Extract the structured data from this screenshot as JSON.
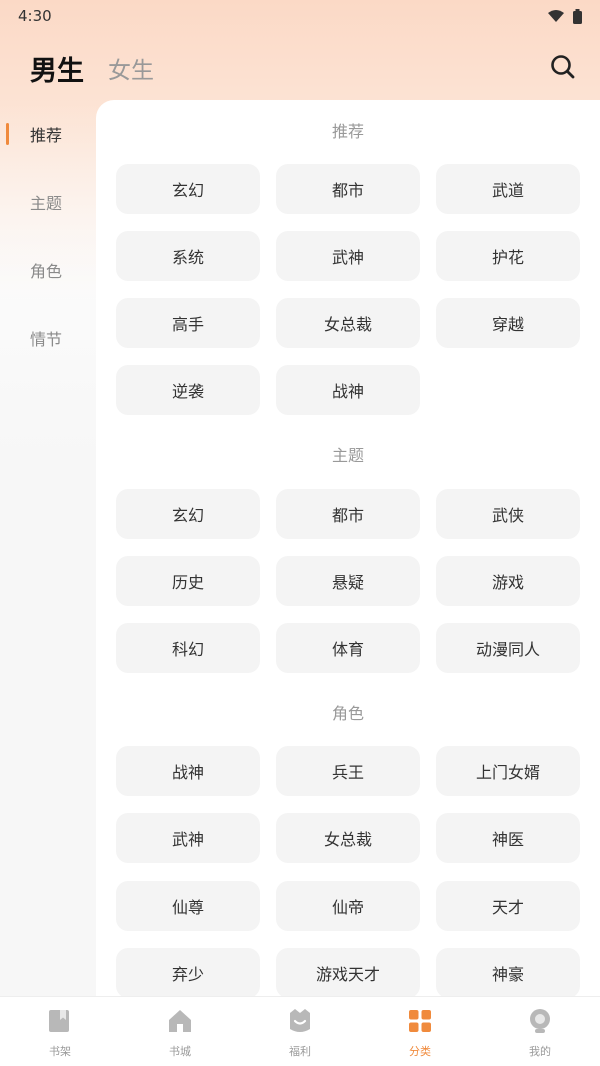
{
  "status_bar": {
    "time": "4:30"
  },
  "header": {
    "tab_male": "男生",
    "tab_female": "女生"
  },
  "sidebar": {
    "items": [
      "推荐",
      "主题",
      "角色",
      "情节"
    ]
  },
  "sections": [
    {
      "title": "推荐",
      "tags": [
        "玄幻",
        "都市",
        "武道",
        "系统",
        "武神",
        "护花",
        "高手",
        "女总裁",
        "穿越",
        "逆袭",
        "战神"
      ]
    },
    {
      "title": "主题",
      "tags": [
        "玄幻",
        "都市",
        "武侠",
        "历史",
        "悬疑",
        "游戏",
        "科幻",
        "体育",
        "动漫同人"
      ]
    },
    {
      "title": "角色",
      "tags": [
        "战神",
        "兵王",
        "上门女婿",
        "武神",
        "女总裁",
        "神医",
        "仙尊",
        "仙帝",
        "天才",
        "弃少",
        "游戏天才",
        "神豪"
      ]
    }
  ],
  "bottom_nav": {
    "items": [
      {
        "label": "书架",
        "icon": "bookshelf-icon"
      },
      {
        "label": "书城",
        "icon": "home-icon"
      },
      {
        "label": "福利",
        "icon": "gift-icon"
      },
      {
        "label": "分类",
        "icon": "category-icon"
      },
      {
        "label": "我的",
        "icon": "profile-icon"
      }
    ],
    "active_index": 3
  },
  "colors": {
    "accent": "#f08a3c",
    "tag_bg": "#f4f4f4",
    "header_bg": "#fbd9c6"
  }
}
